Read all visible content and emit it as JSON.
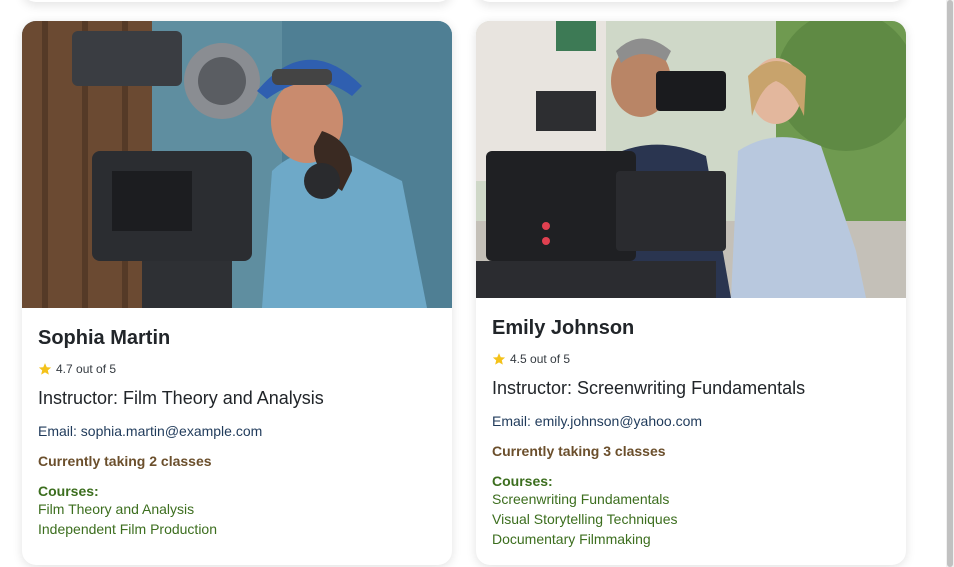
{
  "instructors": [
    {
      "name": "Sophia Martin",
      "rating": "4.7 out of 5",
      "role": "Instructor: Film Theory and Analysis",
      "email": "Email: sophia.martin@example.com",
      "taking": "Currently taking 2 classes",
      "courses_label": "Courses:",
      "courses": [
        "Film Theory and Analysis",
        "Independent Film Production"
      ]
    },
    {
      "name": "Emily Johnson",
      "rating": "4.5 out of 5",
      "role": "Instructor: Screenwriting Fundamentals",
      "email": "Email: emily.johnson@yahoo.com",
      "taking": "Currently taking 3 classes",
      "courses_label": "Courses:",
      "courses": [
        "Screenwriting Fundamentals",
        "Visual Storytelling Techniques",
        "Documentary Filmmaking"
      ]
    }
  ],
  "colors": {
    "star": "#f4c21a",
    "email": "#1f3a5a",
    "taking": "#6b4f2c",
    "courses": "#3c6e1e"
  }
}
